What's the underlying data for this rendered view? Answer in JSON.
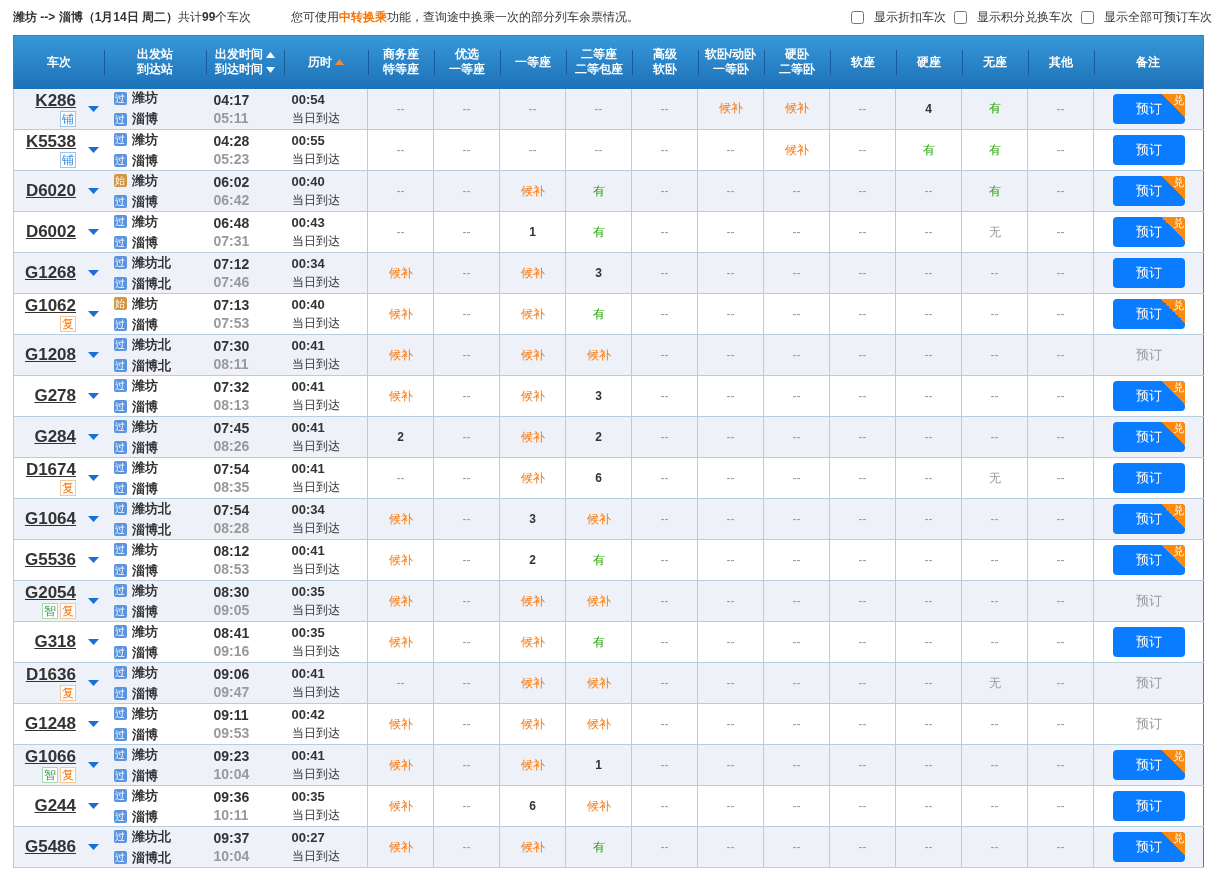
{
  "summary": "**潍坊 --> 淄博（1月14日  周二）**共计**99**个车次",
  "notice": "您可使用**中转换乘**功能，查询途中换乘一次的部分列车余票情况。",
  "filters": [
    {
      "label": "显示折扣车次",
      "checked": false
    },
    {
      "label": "显示积分兑换车次",
      "checked": false
    },
    {
      "label": "显示全部可预订车次",
      "checked": false
    }
  ],
  "columns": [
    {
      "kind": "plain",
      "label": "车次"
    },
    {
      "kind": "plain",
      "lines": [
        "出发站",
        "到达站"
      ]
    },
    {
      "kind": "time",
      "lines": [
        "出发时间",
        "到达时间"
      ]
    },
    {
      "kind": "sorted",
      "label": "历时"
    },
    {
      "kind": "plain",
      "lines": [
        "商务座",
        "特等座"
      ]
    },
    {
      "kind": "plain",
      "lines": [
        "优选",
        "一等座"
      ]
    },
    {
      "kind": "plain",
      "label": "一等座"
    },
    {
      "kind": "plain",
      "lines": [
        "二等座",
        "二等包座"
      ]
    },
    {
      "kind": "plain",
      "lines": [
        "高级",
        "软卧"
      ]
    },
    {
      "kind": "plain",
      "lines": [
        "软卧/动卧",
        "一等卧"
      ]
    },
    {
      "kind": "plain",
      "lines": [
        "硬卧",
        "二等卧"
      ]
    },
    {
      "kind": "plain",
      "label": "软座"
    },
    {
      "kind": "plain",
      "label": "硬座"
    },
    {
      "kind": "plain",
      "label": "无座"
    },
    {
      "kind": "plain",
      "label": "其他"
    },
    {
      "kind": "plain",
      "label": "备注"
    }
  ],
  "rows": [
    {
      "train": "K286",
      "badges": [
        {
          "text": "铺",
          "kind": "berth"
        }
      ],
      "from": {
        "tag": "过",
        "kind": "pass",
        "name": "潍坊"
      },
      "to": {
        "tag": "过",
        "kind": "pass",
        "name": "淄博"
      },
      "depart": "04:17",
      "arrive": "05:11",
      "duration": "00:54",
      "arrival_day": "当日到达",
      "seats": [
        {
          "text": "--",
          "kind": "dash"
        },
        {
          "text": "--",
          "kind": "dash"
        },
        {
          "text": "--",
          "kind": "dash"
        },
        {
          "text": "--",
          "kind": "dash"
        },
        {
          "text": "--",
          "kind": "dash"
        },
        {
          "text": "候补",
          "kind": "wait"
        },
        {
          "text": "候补",
          "kind": "wait"
        },
        {
          "text": "--",
          "kind": "dash"
        },
        {
          "text": "4",
          "kind": "num"
        },
        {
          "text": "有",
          "kind": "yes"
        },
        {
          "text": "--",
          "kind": "dash"
        }
      ],
      "book": {
        "label": "预订",
        "disabled": false,
        "exchange_badge": "兑"
      }
    },
    {
      "train": "K5538",
      "badges": [
        {
          "text": "铺",
          "kind": "berth"
        }
      ],
      "from": {
        "tag": "过",
        "kind": "pass",
        "name": "潍坊"
      },
      "to": {
        "tag": "过",
        "kind": "pass",
        "name": "淄博"
      },
      "depart": "04:28",
      "arrive": "05:23",
      "duration": "00:55",
      "arrival_day": "当日到达",
      "seats": [
        {
          "text": "--",
          "kind": "dash"
        },
        {
          "text": "--",
          "kind": "dash"
        },
        {
          "text": "--",
          "kind": "dash"
        },
        {
          "text": "--",
          "kind": "dash"
        },
        {
          "text": "--",
          "kind": "dash"
        },
        {
          "text": "--",
          "kind": "dash"
        },
        {
          "text": "候补",
          "kind": "wait"
        },
        {
          "text": "--",
          "kind": "dash"
        },
        {
          "text": "有",
          "kind": "yes"
        },
        {
          "text": "有",
          "kind": "yes"
        },
        {
          "text": "--",
          "kind": "dash"
        }
      ],
      "book": {
        "label": "预订",
        "disabled": false
      }
    },
    {
      "train": "D6020",
      "badges": [],
      "from": {
        "tag": "始",
        "kind": "start",
        "name": "潍坊"
      },
      "to": {
        "tag": "过",
        "kind": "pass",
        "name": "淄博"
      },
      "depart": "06:02",
      "arrive": "06:42",
      "duration": "00:40",
      "arrival_day": "当日到达",
      "seats": [
        {
          "text": "--",
          "kind": "dash"
        },
        {
          "text": "--",
          "kind": "dash"
        },
        {
          "text": "候补",
          "kind": "wait"
        },
        {
          "text": "有",
          "kind": "yes"
        },
        {
          "text": "--",
          "kind": "dash"
        },
        {
          "text": "--",
          "kind": "dash"
        },
        {
          "text": "--",
          "kind": "dash"
        },
        {
          "text": "--",
          "kind": "dash"
        },
        {
          "text": "--",
          "kind": "dash"
        },
        {
          "text": "有",
          "kind": "yes"
        },
        {
          "text": "--",
          "kind": "dash"
        }
      ],
      "book": {
        "label": "预订",
        "disabled": false,
        "exchange_badge": "兑"
      }
    },
    {
      "train": "D6002",
      "badges": [],
      "from": {
        "tag": "过",
        "kind": "pass",
        "name": "潍坊"
      },
      "to": {
        "tag": "过",
        "kind": "pass",
        "name": "淄博"
      },
      "depart": "06:48",
      "arrive": "07:31",
      "duration": "00:43",
      "arrival_day": "当日到达",
      "seats": [
        {
          "text": "--",
          "kind": "dash"
        },
        {
          "text": "--",
          "kind": "dash"
        },
        {
          "text": "1",
          "kind": "num"
        },
        {
          "text": "有",
          "kind": "yes"
        },
        {
          "text": "--",
          "kind": "dash"
        },
        {
          "text": "--",
          "kind": "dash"
        },
        {
          "text": "--",
          "kind": "dash"
        },
        {
          "text": "--",
          "kind": "dash"
        },
        {
          "text": "--",
          "kind": "dash"
        },
        {
          "text": "无",
          "kind": "no"
        },
        {
          "text": "--",
          "kind": "dash"
        }
      ],
      "book": {
        "label": "预订",
        "disabled": false,
        "exchange_badge": "兑"
      }
    },
    {
      "train": "G1268",
      "badges": [],
      "from": {
        "tag": "过",
        "kind": "pass",
        "name": "潍坊北"
      },
      "to": {
        "tag": "过",
        "kind": "pass",
        "name": "淄博北"
      },
      "depart": "07:12",
      "arrive": "07:46",
      "duration": "00:34",
      "arrival_day": "当日到达",
      "seats": [
        {
          "text": "候补",
          "kind": "wait"
        },
        {
          "text": "--",
          "kind": "dash"
        },
        {
          "text": "候补",
          "kind": "wait"
        },
        {
          "text": "3",
          "kind": "num"
        },
        {
          "text": "--",
          "kind": "dash"
        },
        {
          "text": "--",
          "kind": "dash"
        },
        {
          "text": "--",
          "kind": "dash"
        },
        {
          "text": "--",
          "kind": "dash"
        },
        {
          "text": "--",
          "kind": "dash"
        },
        {
          "text": "--",
          "kind": "dash"
        },
        {
          "text": "--",
          "kind": "dash"
        }
      ],
      "book": {
        "label": "预订",
        "disabled": false
      }
    },
    {
      "train": "G1062",
      "badges": [
        {
          "text": "复",
          "kind": "fuxing"
        }
      ],
      "from": {
        "tag": "始",
        "kind": "start",
        "name": "潍坊"
      },
      "to": {
        "tag": "过",
        "kind": "pass",
        "name": "淄博"
      },
      "depart": "07:13",
      "arrive": "07:53",
      "duration": "00:40",
      "arrival_day": "当日到达",
      "seats": [
        {
          "text": "候补",
          "kind": "wait"
        },
        {
          "text": "--",
          "kind": "dash"
        },
        {
          "text": "候补",
          "kind": "wait"
        },
        {
          "text": "有",
          "kind": "yes"
        },
        {
          "text": "--",
          "kind": "dash"
        },
        {
          "text": "--",
          "kind": "dash"
        },
        {
          "text": "--",
          "kind": "dash"
        },
        {
          "text": "--",
          "kind": "dash"
        },
        {
          "text": "--",
          "kind": "dash"
        },
        {
          "text": "--",
          "kind": "dash"
        },
        {
          "text": "--",
          "kind": "dash"
        }
      ],
      "book": {
        "label": "预订",
        "disabled": false,
        "exchange_badge": "兑"
      }
    },
    {
      "train": "G1208",
      "badges": [],
      "from": {
        "tag": "过",
        "kind": "pass",
        "name": "潍坊北"
      },
      "to": {
        "tag": "过",
        "kind": "pass",
        "name": "淄博北"
      },
      "depart": "07:30",
      "arrive": "08:11",
      "duration": "00:41",
      "arrival_day": "当日到达",
      "seats": [
        {
          "text": "候补",
          "kind": "wait"
        },
        {
          "text": "--",
          "kind": "dash"
        },
        {
          "text": "候补",
          "kind": "wait"
        },
        {
          "text": "候补",
          "kind": "wait"
        },
        {
          "text": "--",
          "kind": "dash"
        },
        {
          "text": "--",
          "kind": "dash"
        },
        {
          "text": "--",
          "kind": "dash"
        },
        {
          "text": "--",
          "kind": "dash"
        },
        {
          "text": "--",
          "kind": "dash"
        },
        {
          "text": "--",
          "kind": "dash"
        },
        {
          "text": "--",
          "kind": "dash"
        }
      ],
      "book": {
        "label": "预订",
        "disabled": true
      }
    },
    {
      "train": "G278",
      "badges": [],
      "from": {
        "tag": "过",
        "kind": "pass",
        "name": "潍坊"
      },
      "to": {
        "tag": "过",
        "kind": "pass",
        "name": "淄博"
      },
      "depart": "07:32",
      "arrive": "08:13",
      "duration": "00:41",
      "arrival_day": "当日到达",
      "seats": [
        {
          "text": "候补",
          "kind": "wait"
        },
        {
          "text": "--",
          "kind": "dash"
        },
        {
          "text": "候补",
          "kind": "wait"
        },
        {
          "text": "3",
          "kind": "num"
        },
        {
          "text": "--",
          "kind": "dash"
        },
        {
          "text": "--",
          "kind": "dash"
        },
        {
          "text": "--",
          "kind": "dash"
        },
        {
          "text": "--",
          "kind": "dash"
        },
        {
          "text": "--",
          "kind": "dash"
        },
        {
          "text": "--",
          "kind": "dash"
        },
        {
          "text": "--",
          "kind": "dash"
        }
      ],
      "book": {
        "label": "预订",
        "disabled": false,
        "exchange_badge": "兑"
      }
    },
    {
      "train": "G284",
      "badges": [],
      "from": {
        "tag": "过",
        "kind": "pass",
        "name": "潍坊"
      },
      "to": {
        "tag": "过",
        "kind": "pass",
        "name": "淄博"
      },
      "depart": "07:45",
      "arrive": "08:26",
      "duration": "00:41",
      "arrival_day": "当日到达",
      "seats": [
        {
          "text": "2",
          "kind": "num"
        },
        {
          "text": "--",
          "kind": "dash"
        },
        {
          "text": "候补",
          "kind": "wait"
        },
        {
          "text": "2",
          "kind": "num"
        },
        {
          "text": "--",
          "kind": "dash"
        },
        {
          "text": "--",
          "kind": "dash"
        },
        {
          "text": "--",
          "kind": "dash"
        },
        {
          "text": "--",
          "kind": "dash"
        },
        {
          "text": "--",
          "kind": "dash"
        },
        {
          "text": "--",
          "kind": "dash"
        },
        {
          "text": "--",
          "kind": "dash"
        }
      ],
      "book": {
        "label": "预订",
        "disabled": false,
        "exchange_badge": "兑"
      }
    },
    {
      "train": "D1674",
      "badges": [
        {
          "text": "复",
          "kind": "fuxing"
        }
      ],
      "from": {
        "tag": "过",
        "kind": "pass",
        "name": "潍坊"
      },
      "to": {
        "tag": "过",
        "kind": "pass",
        "name": "淄博"
      },
      "depart": "07:54",
      "arrive": "08:35",
      "duration": "00:41",
      "arrival_day": "当日到达",
      "seats": [
        {
          "text": "--",
          "kind": "dash"
        },
        {
          "text": "--",
          "kind": "dash"
        },
        {
          "text": "候补",
          "kind": "wait"
        },
        {
          "text": "6",
          "kind": "num"
        },
        {
          "text": "--",
          "kind": "dash"
        },
        {
          "text": "--",
          "kind": "dash"
        },
        {
          "text": "--",
          "kind": "dash"
        },
        {
          "text": "--",
          "kind": "dash"
        },
        {
          "text": "--",
          "kind": "dash"
        },
        {
          "text": "无",
          "kind": "no"
        },
        {
          "text": "--",
          "kind": "dash"
        }
      ],
      "book": {
        "label": "预订",
        "disabled": false
      }
    },
    {
      "train": "G1064",
      "badges": [],
      "from": {
        "tag": "过",
        "kind": "pass",
        "name": "潍坊北"
      },
      "to": {
        "tag": "过",
        "kind": "pass",
        "name": "淄博北"
      },
      "depart": "07:54",
      "arrive": "08:28",
      "duration": "00:34",
      "arrival_day": "当日到达",
      "seats": [
        {
          "text": "候补",
          "kind": "wait"
        },
        {
          "text": "--",
          "kind": "dash"
        },
        {
          "text": "3",
          "kind": "num"
        },
        {
          "text": "候补",
          "kind": "wait"
        },
        {
          "text": "--",
          "kind": "dash"
        },
        {
          "text": "--",
          "kind": "dash"
        },
        {
          "text": "--",
          "kind": "dash"
        },
        {
          "text": "--",
          "kind": "dash"
        },
        {
          "text": "--",
          "kind": "dash"
        },
        {
          "text": "--",
          "kind": "dash"
        },
        {
          "text": "--",
          "kind": "dash"
        }
      ],
      "book": {
        "label": "预订",
        "disabled": false,
        "exchange_badge": "兑"
      }
    },
    {
      "train": "G5536",
      "badges": [],
      "from": {
        "tag": "过",
        "kind": "pass",
        "name": "潍坊"
      },
      "to": {
        "tag": "过",
        "kind": "pass",
        "name": "淄博"
      },
      "depart": "08:12",
      "arrive": "08:53",
      "duration": "00:41",
      "arrival_day": "当日到达",
      "seats": [
        {
          "text": "候补",
          "kind": "wait"
        },
        {
          "text": "--",
          "kind": "dash"
        },
        {
          "text": "2",
          "kind": "num"
        },
        {
          "text": "有",
          "kind": "yes"
        },
        {
          "text": "--",
          "kind": "dash"
        },
        {
          "text": "--",
          "kind": "dash"
        },
        {
          "text": "--",
          "kind": "dash"
        },
        {
          "text": "--",
          "kind": "dash"
        },
        {
          "text": "--",
          "kind": "dash"
        },
        {
          "text": "--",
          "kind": "dash"
        },
        {
          "text": "--",
          "kind": "dash"
        }
      ],
      "book": {
        "label": "预订",
        "disabled": false,
        "exchange_badge": "兑"
      }
    },
    {
      "train": "G2054",
      "badges": [
        {
          "text": "智",
          "kind": "smart"
        },
        {
          "text": "复",
          "kind": "fuxing"
        }
      ],
      "from": {
        "tag": "过",
        "kind": "pass",
        "name": "潍坊"
      },
      "to": {
        "tag": "过",
        "kind": "pass",
        "name": "淄博"
      },
      "depart": "08:30",
      "arrive": "09:05",
      "duration": "00:35",
      "arrival_day": "当日到达",
      "seats": [
        {
          "text": "候补",
          "kind": "wait"
        },
        {
          "text": "--",
          "kind": "dash"
        },
        {
          "text": "候补",
          "kind": "wait"
        },
        {
          "text": "候补",
          "kind": "wait"
        },
        {
          "text": "--",
          "kind": "dash"
        },
        {
          "text": "--",
          "kind": "dash"
        },
        {
          "text": "--",
          "kind": "dash"
        },
        {
          "text": "--",
          "kind": "dash"
        },
        {
          "text": "--",
          "kind": "dash"
        },
        {
          "text": "--",
          "kind": "dash"
        },
        {
          "text": "--",
          "kind": "dash"
        }
      ],
      "book": {
        "label": "预订",
        "disabled": true
      }
    },
    {
      "train": "G318",
      "badges": [],
      "from": {
        "tag": "过",
        "kind": "pass",
        "name": "潍坊"
      },
      "to": {
        "tag": "过",
        "kind": "pass",
        "name": "淄博"
      },
      "depart": "08:41",
      "arrive": "09:16",
      "duration": "00:35",
      "arrival_day": "当日到达",
      "seats": [
        {
          "text": "候补",
          "kind": "wait"
        },
        {
          "text": "--",
          "kind": "dash"
        },
        {
          "text": "候补",
          "kind": "wait"
        },
        {
          "text": "有",
          "kind": "yes"
        },
        {
          "text": "--",
          "kind": "dash"
        },
        {
          "text": "--",
          "kind": "dash"
        },
        {
          "text": "--",
          "kind": "dash"
        },
        {
          "text": "--",
          "kind": "dash"
        },
        {
          "text": "--",
          "kind": "dash"
        },
        {
          "text": "--",
          "kind": "dash"
        },
        {
          "text": "--",
          "kind": "dash"
        }
      ],
      "book": {
        "label": "预订",
        "disabled": false
      }
    },
    {
      "train": "D1636",
      "badges": [
        {
          "text": "复",
          "kind": "fuxing"
        }
      ],
      "from": {
        "tag": "过",
        "kind": "pass",
        "name": "潍坊"
      },
      "to": {
        "tag": "过",
        "kind": "pass",
        "name": "淄博"
      },
      "depart": "09:06",
      "arrive": "09:47",
      "duration": "00:41",
      "arrival_day": "当日到达",
      "seats": [
        {
          "text": "--",
          "kind": "dash"
        },
        {
          "text": "--",
          "kind": "dash"
        },
        {
          "text": "候补",
          "kind": "wait"
        },
        {
          "text": "候补",
          "kind": "wait"
        },
        {
          "text": "--",
          "kind": "dash"
        },
        {
          "text": "--",
          "kind": "dash"
        },
        {
          "text": "--",
          "kind": "dash"
        },
        {
          "text": "--",
          "kind": "dash"
        },
        {
          "text": "--",
          "kind": "dash"
        },
        {
          "text": "无",
          "kind": "no"
        },
        {
          "text": "--",
          "kind": "dash"
        }
      ],
      "book": {
        "label": "预订",
        "disabled": true
      }
    },
    {
      "train": "G1248",
      "badges": [],
      "from": {
        "tag": "过",
        "kind": "pass",
        "name": "潍坊"
      },
      "to": {
        "tag": "过",
        "kind": "pass",
        "name": "淄博"
      },
      "depart": "09:11",
      "arrive": "09:53",
      "duration": "00:42",
      "arrival_day": "当日到达",
      "seats": [
        {
          "text": "候补",
          "kind": "wait"
        },
        {
          "text": "--",
          "kind": "dash"
        },
        {
          "text": "候补",
          "kind": "wait"
        },
        {
          "text": "候补",
          "kind": "wait"
        },
        {
          "text": "--",
          "kind": "dash"
        },
        {
          "text": "--",
          "kind": "dash"
        },
        {
          "text": "--",
          "kind": "dash"
        },
        {
          "text": "--",
          "kind": "dash"
        },
        {
          "text": "--",
          "kind": "dash"
        },
        {
          "text": "--",
          "kind": "dash"
        },
        {
          "text": "--",
          "kind": "dash"
        }
      ],
      "book": {
        "label": "预订",
        "disabled": true
      }
    },
    {
      "train": "G1066",
      "badges": [
        {
          "text": "智",
          "kind": "smart"
        },
        {
          "text": "复",
          "kind": "fuxing"
        }
      ],
      "from": {
        "tag": "过",
        "kind": "pass",
        "name": "潍坊"
      },
      "to": {
        "tag": "过",
        "kind": "pass",
        "name": "淄博"
      },
      "depart": "09:23",
      "arrive": "10:04",
      "duration": "00:41",
      "arrival_day": "当日到达",
      "seats": [
        {
          "text": "候补",
          "kind": "wait"
        },
        {
          "text": "--",
          "kind": "dash"
        },
        {
          "text": "候补",
          "kind": "wait"
        },
        {
          "text": "1",
          "kind": "num"
        },
        {
          "text": "--",
          "kind": "dash"
        },
        {
          "text": "--",
          "kind": "dash"
        },
        {
          "text": "--",
          "kind": "dash"
        },
        {
          "text": "--",
          "kind": "dash"
        },
        {
          "text": "--",
          "kind": "dash"
        },
        {
          "text": "--",
          "kind": "dash"
        },
        {
          "text": "--",
          "kind": "dash"
        }
      ],
      "book": {
        "label": "预订",
        "disabled": false,
        "exchange_badge": "兑"
      }
    },
    {
      "train": "G244",
      "badges": [],
      "from": {
        "tag": "过",
        "kind": "pass",
        "name": "潍坊"
      },
      "to": {
        "tag": "过",
        "kind": "pass",
        "name": "淄博"
      },
      "depart": "09:36",
      "arrive": "10:11",
      "duration": "00:35",
      "arrival_day": "当日到达",
      "seats": [
        {
          "text": "候补",
          "kind": "wait"
        },
        {
          "text": "--",
          "kind": "dash"
        },
        {
          "text": "6",
          "kind": "num"
        },
        {
          "text": "候补",
          "kind": "wait"
        },
        {
          "text": "--",
          "kind": "dash"
        },
        {
          "text": "--",
          "kind": "dash"
        },
        {
          "text": "--",
          "kind": "dash"
        },
        {
          "text": "--",
          "kind": "dash"
        },
        {
          "text": "--",
          "kind": "dash"
        },
        {
          "text": "--",
          "kind": "dash"
        },
        {
          "text": "--",
          "kind": "dash"
        }
      ],
      "book": {
        "label": "预订",
        "disabled": false
      }
    },
    {
      "train": "G5486",
      "badges": [],
      "from": {
        "tag": "过",
        "kind": "pass",
        "name": "潍坊北"
      },
      "to": {
        "tag": "过",
        "kind": "pass",
        "name": "淄博北"
      },
      "depart": "09:37",
      "arrive": "10:04",
      "duration": "00:27",
      "arrival_day": "当日到达",
      "seats": [
        {
          "text": "候补",
          "kind": "wait"
        },
        {
          "text": "--",
          "kind": "dash"
        },
        {
          "text": "候补",
          "kind": "wait"
        },
        {
          "text": "有",
          "kind": "yes"
        },
        {
          "text": "--",
          "kind": "dash"
        },
        {
          "text": "--",
          "kind": "dash"
        },
        {
          "text": "--",
          "kind": "dash"
        },
        {
          "text": "--",
          "kind": "dash"
        },
        {
          "text": "--",
          "kind": "dash"
        },
        {
          "text": "--",
          "kind": "dash"
        },
        {
          "text": "--",
          "kind": "dash"
        }
      ],
      "book": {
        "label": "预订",
        "disabled": false,
        "exchange_badge": "兑"
      }
    }
  ]
}
